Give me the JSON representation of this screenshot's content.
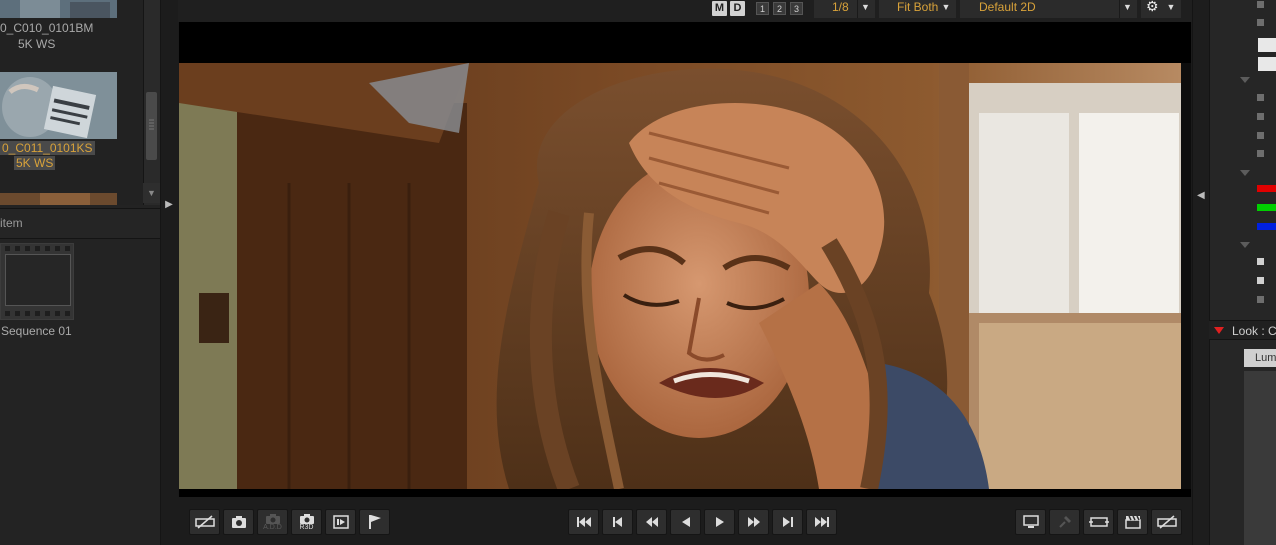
{
  "browser": {
    "clips": [
      {
        "name": "0_C010_0101BM",
        "format": "5K WS",
        "selected": false
      },
      {
        "name": "0_C011_0101KS",
        "format": "5K WS",
        "selected": true
      }
    ],
    "item_header": "item",
    "sequence": {
      "label": "Sequence 01"
    }
  },
  "viewer": {
    "toolbar": {
      "key_m": "M",
      "key_d": "D",
      "num_1": "1",
      "num_2": "2",
      "num_3": "3",
      "resolution": "1/8",
      "fit_mode": "Fit Both",
      "lut": "Default 2D"
    },
    "transport": {
      "left_tools": [
        "clear-flags",
        "snapshot",
        "snapshot-add",
        "snapshot-r3d",
        "export-frame",
        "flag"
      ],
      "add_label": "A.D.D",
      "r3d_label": "R3D",
      "playback": [
        "go-to-start",
        "previous-frame-mark",
        "rewind",
        "play-reverse",
        "play",
        "fast-forward",
        "next-frame-mark",
        "go-to-end"
      ],
      "right_tools": [
        "monitor",
        "pin",
        "loop",
        "clapper",
        "clear-marks"
      ]
    }
  },
  "right_panel": {
    "look_header": "Look : C",
    "lum_tab": "Lum",
    "colors": {
      "red": "#e00000",
      "green": "#00d000",
      "blue": "#0020e0",
      "accent": "#d8a23a"
    }
  }
}
